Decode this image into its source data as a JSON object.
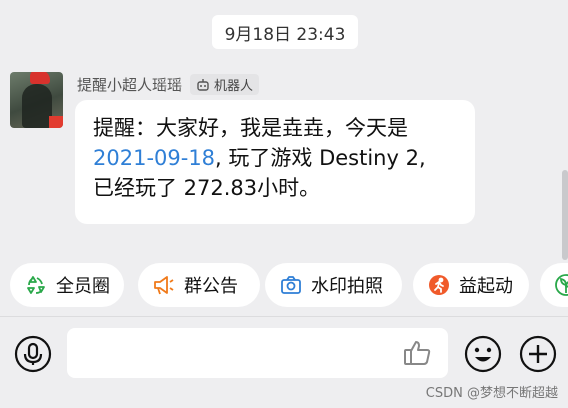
{
  "timestamp": "9月18日 23:43",
  "message": {
    "sender_name": "提醒小超人瑶瑶",
    "bot_badge": "机器人",
    "line1": "提醒：大家好，我是垚垚，今天是",
    "date_link": "2021-09-18",
    "line2_rest": ", 玩了游戏 Destiny 2,",
    "line3": "已经玩了 272.83小时。"
  },
  "quick_actions": [
    {
      "label": "全员圈",
      "icon": "recycle-icon",
      "color": "#2aa84a"
    },
    {
      "label": "群公告",
      "icon": "megaphone-icon",
      "color": "#f07a1a"
    },
    {
      "label": "水印拍照",
      "icon": "camera-icon",
      "color": "#2f7fd6"
    },
    {
      "label": "益起动",
      "icon": "run-icon",
      "color": "#f05a2a"
    },
    {
      "label": "",
      "icon": "plant-icon",
      "color": "#2aa84a"
    }
  ],
  "watermark": "CSDN @梦想不断超越"
}
